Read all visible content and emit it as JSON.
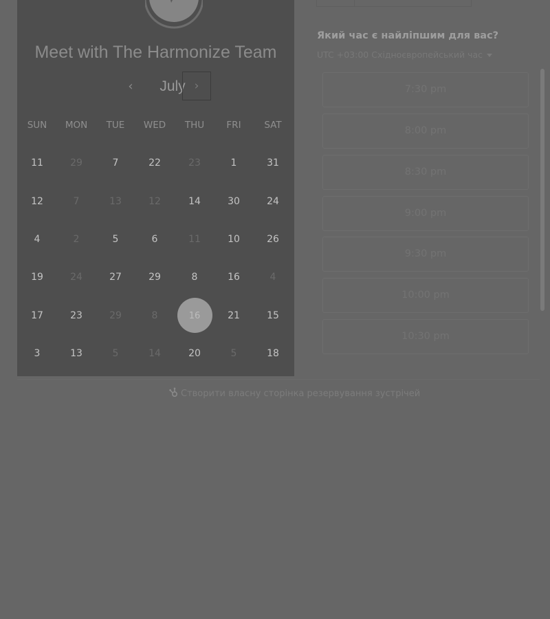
{
  "header": {
    "title": "Meet with The Harmonize Team",
    "avatar_icon": "chat-bubble-icon"
  },
  "calendar": {
    "month": "July",
    "prev_icon": "chevron-left-icon",
    "next_icon": "chevron-right-icon",
    "weekdays": [
      "SUN",
      "MON",
      "TUE",
      "WED",
      "THU",
      "FRI",
      "SAT"
    ],
    "weeks": [
      [
        {
          "d": "11",
          "muted": false
        },
        {
          "d": "29",
          "muted": true
        },
        {
          "d": "7",
          "muted": false
        },
        {
          "d": "22",
          "muted": false
        },
        {
          "d": "23",
          "muted": true
        },
        {
          "d": "1",
          "muted": false
        },
        {
          "d": "31",
          "muted": false
        }
      ],
      [
        {
          "d": "12",
          "muted": false
        },
        {
          "d": "7",
          "muted": true
        },
        {
          "d": "13",
          "muted": true
        },
        {
          "d": "12",
          "muted": true
        },
        {
          "d": "14",
          "muted": false
        },
        {
          "d": "30",
          "muted": false
        },
        {
          "d": "24",
          "muted": false
        }
      ],
      [
        {
          "d": "4",
          "muted": false
        },
        {
          "d": "2",
          "muted": true
        },
        {
          "d": "5",
          "muted": false
        },
        {
          "d": "6",
          "muted": false
        },
        {
          "d": "11",
          "muted": true
        },
        {
          "d": "10",
          "muted": false
        },
        {
          "d": "26",
          "muted": false
        }
      ],
      [
        {
          "d": "19",
          "muted": false
        },
        {
          "d": "24",
          "muted": true
        },
        {
          "d": "27",
          "muted": false
        },
        {
          "d": "29",
          "muted": false
        },
        {
          "d": "8",
          "muted": false
        },
        {
          "d": "16",
          "muted": false
        },
        {
          "d": "4",
          "muted": true
        }
      ],
      [
        {
          "d": "17",
          "muted": false
        },
        {
          "d": "23",
          "muted": false
        },
        {
          "d": "29",
          "muted": true
        },
        {
          "d": "8",
          "muted": true
        },
        {
          "d": "16",
          "muted": false,
          "selected": true
        },
        {
          "d": "21",
          "muted": false
        },
        {
          "d": "15",
          "muted": false
        }
      ],
      [
        {
          "d": "3",
          "muted": false
        },
        {
          "d": "13",
          "muted": false
        },
        {
          "d": "5",
          "muted": true
        },
        {
          "d": "14",
          "muted": true
        },
        {
          "d": "20",
          "muted": false
        },
        {
          "d": "5",
          "muted": true
        },
        {
          "d": "18",
          "muted": false
        }
      ]
    ]
  },
  "times": {
    "question": "Який час є найліпшим для вас?",
    "timezone": "UTC +03:00 Східноєвропейський час",
    "slots": [
      "7:30 pm",
      "8:00 pm",
      "8:30 pm",
      "9:00 pm",
      "9:30 pm",
      "10:00 pm",
      "10:30 pm"
    ]
  },
  "footer": {
    "link": "Створити власну сторінка резервування зустрічей",
    "icon": "sprocket-icon"
  },
  "colors": {
    "overlay": "#666666",
    "card": "#4e4e4e",
    "selected_day": "#9a9a9a"
  }
}
